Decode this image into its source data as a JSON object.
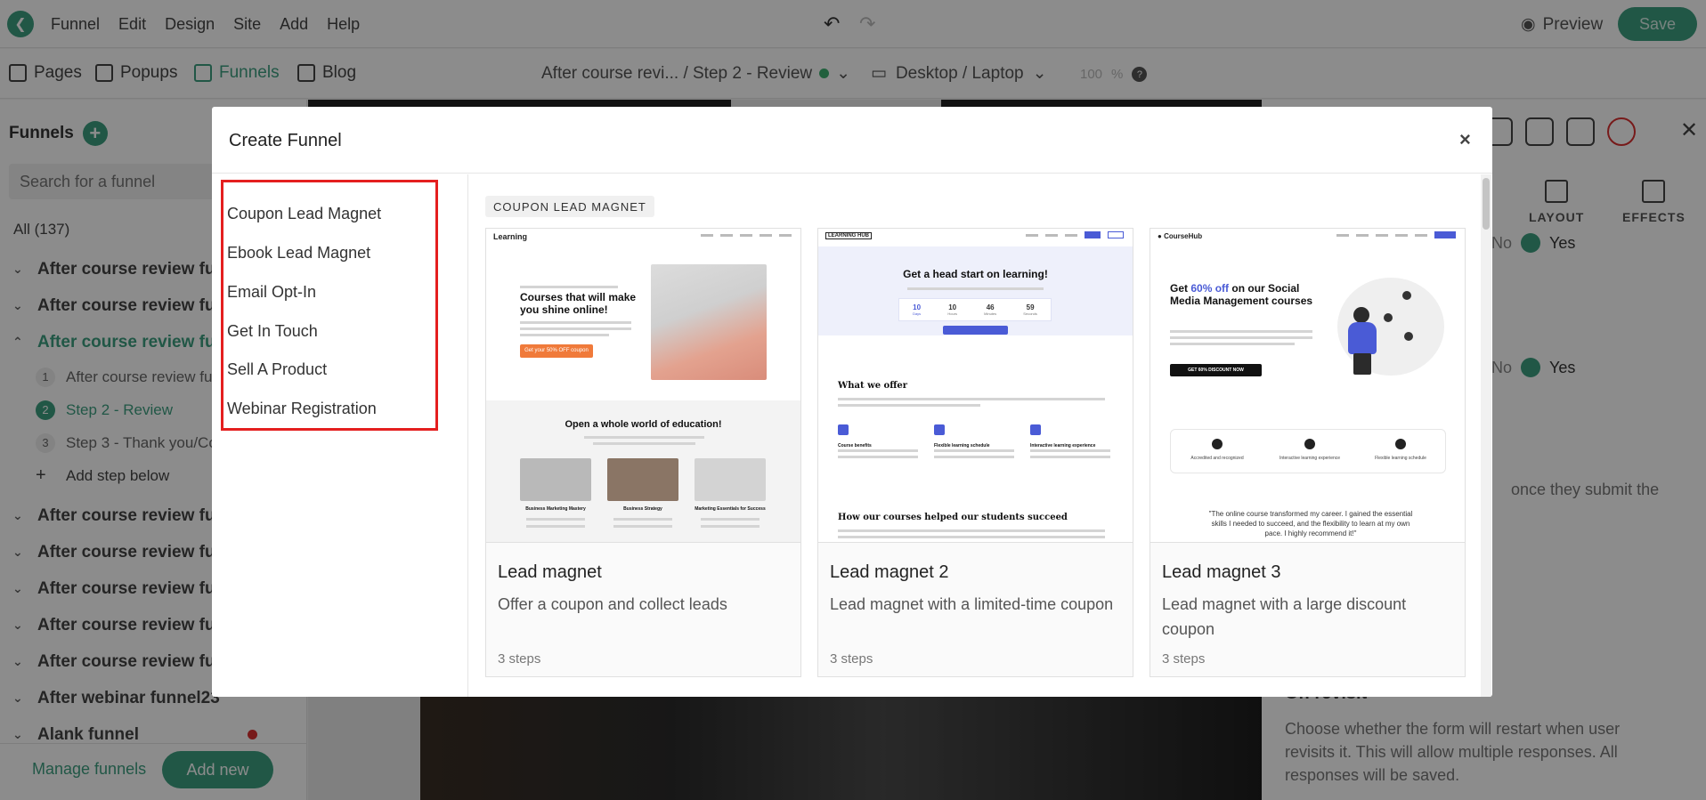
{
  "topbar": {
    "menu": [
      "Funnel",
      "Edit",
      "Design",
      "Site",
      "Add",
      "Help"
    ],
    "preview_label": "Preview",
    "save_label": "Save"
  },
  "subbar": {
    "tabs": [
      "Pages",
      "Popups",
      "Funnels",
      "Blog"
    ],
    "current_step": "After course revi... / Step 2 - Review",
    "device": "Desktop / Laptop",
    "zoom_value": "100",
    "zoom_unit": "%",
    "help": "?"
  },
  "sidebar": {
    "title": "Funnels",
    "search_placeholder": "Search for a funnel",
    "all_label": "All (137)",
    "funnels_top": [
      "After course review funnel",
      "After course review funnel"
    ],
    "open_funnel": "After course review funnel",
    "steps": [
      {
        "num": "1",
        "label": "After course review funnel"
      },
      {
        "num": "2",
        "label": "Step 2 - Review"
      },
      {
        "num": "3",
        "label": "Step 3 - Thank you/Cou"
      }
    ],
    "add_step": "Add step below",
    "funnels_bottom": [
      "After course review funnel",
      "After course review funnel",
      "After course review funnel",
      "After course review funnel",
      "After course review funnel",
      "After webinar funnel23",
      "Alank funnel"
    ],
    "manage_label": "Manage funnels",
    "add_new_label": "Add new"
  },
  "right_panel": {
    "tab_layout": "LAYOUT",
    "tab_effects": "EFFECTS",
    "no_label": "No",
    "yes_label": "Yes",
    "submit_text": "once they submit the",
    "revisit_title": "On revisit",
    "revisit_desc": "Choose whether the form will restart when user revisits it. This will allow multiple responses. All responses will be saved."
  },
  "modal": {
    "title": "Create Funnel",
    "close": "×",
    "categories": [
      "Coupon Lead Magnet",
      "Ebook Lead Magnet",
      "Email Opt-In",
      "Get In Touch",
      "Sell A Product",
      "Webinar Registration"
    ],
    "section_tag": "COUPON LEAD MAGNET",
    "cards": [
      {
        "name": "Lead magnet",
        "desc": "Offer a coupon and collect leads",
        "steps": "3 steps",
        "thumb": {
          "logo": "Learning",
          "headline": "Courses that will make you shine online!",
          "button": "Get your 50% OFF coupon",
          "section": "Open a whole world of education!",
          "items": [
            "Business Marketing Mastery",
            "Business Strategy",
            "Marketing Essentials for Success"
          ]
        }
      },
      {
        "name": "Lead magnet 2",
        "desc": "Lead magnet with a limited-time coupon",
        "steps": "3 steps",
        "thumb": {
          "logo": "LEARNING HUB",
          "headline": "Get a head start on learning!",
          "countdown": [
            {
              "value": "10",
              "unit": "Days"
            },
            {
              "value": "10",
              "unit": "Hours"
            },
            {
              "value": "46",
              "unit": "Minutes"
            },
            {
              "value": "59",
              "unit": "Seconds"
            }
          ],
          "section": "What we offer",
          "features": [
            "Course benefits",
            "Flexible learning schedule",
            "Interactive learning experience"
          ],
          "section2": "How our courses helped our students succeed"
        }
      },
      {
        "name": "Lead magnet 3",
        "desc": "Lead magnet with a large discount coupon",
        "steps": "3 steps",
        "thumb": {
          "logo": "CourseHub",
          "headline_pre": "Get ",
          "headline_hl": "60% off",
          "headline_post": " on our Social Media Management courses",
          "button": "GET 60% DISCOUNT NOW",
          "features": [
            "Accredited and recognized",
            "Interactive learning experience",
            "Flexible learning schedule"
          ],
          "quote": "\"The online course transformed my career. I gained the essential skills I needed to succeed, and the flexibility to learn at my own pace. I highly recommend it!\""
        }
      }
    ]
  },
  "colors": {
    "accent": "#3d9e80",
    "highlight_border": "#e41f1f",
    "danger_dot": "#d93030",
    "thumb_blue": "#4a5bd6",
    "thumb_orange": "#f07a3a"
  }
}
